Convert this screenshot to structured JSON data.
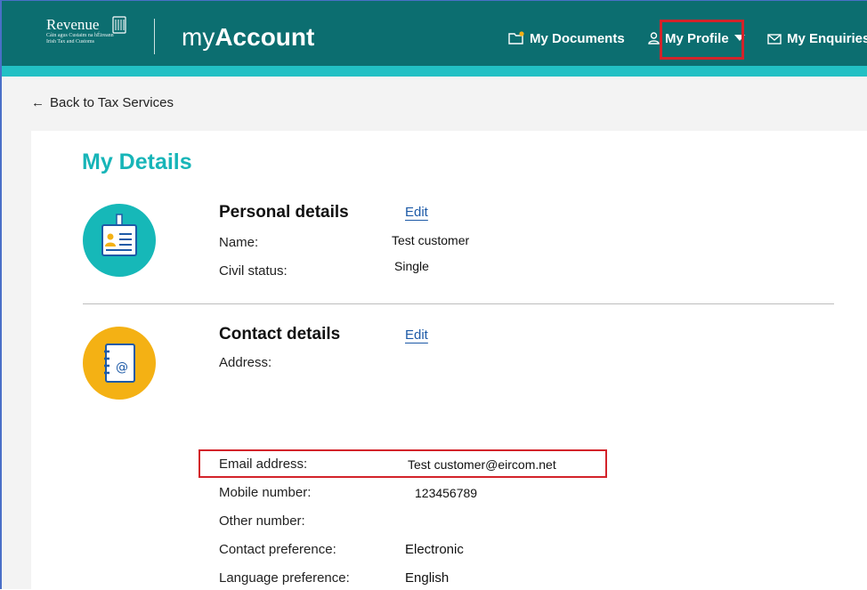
{
  "header": {
    "logo": {
      "word": "Revenue",
      "sub_line1": "Cáin agus Custaim na hÉireann",
      "sub_line2": "Irish Tax and Customs"
    },
    "app_title_prefix": "my",
    "app_title_bold": "Account",
    "nav": {
      "documents": "My Documents",
      "profile": "My Profile",
      "enquiries": "My Enquiries"
    }
  },
  "back_link": "Back to Tax Services",
  "page_title": "My Details",
  "personal": {
    "title": "Personal details",
    "edit": "Edit",
    "rows": [
      {
        "label": "Name:",
        "value": "Test customer"
      },
      {
        "label": "Civil status:",
        "value": "Single"
      }
    ]
  },
  "contact": {
    "title": "Contact details",
    "edit": "Edit",
    "address_label": "Address:",
    "rows": [
      {
        "label": "Email address:",
        "value": "Test customer@eircom.net"
      },
      {
        "label": "Mobile number:",
        "value": "123456789"
      },
      {
        "label": "Other number:",
        "value": ""
      },
      {
        "label": "Contact preference:",
        "value": "Electronic"
      },
      {
        "label": "Language preference:",
        "value": "English"
      }
    ]
  },
  "colors": {
    "header_bg": "#0c6e70",
    "accent_teal": "#17b5b8",
    "accent_yellow": "#f4b114",
    "highlight_red": "#d3232a",
    "link_blue": "#1d5aa7"
  },
  "icons": [
    "folder-icon",
    "user-icon",
    "envelope-icon",
    "arrow-left-icon",
    "id-badge-icon",
    "address-book-icon",
    "harp-icon"
  ]
}
